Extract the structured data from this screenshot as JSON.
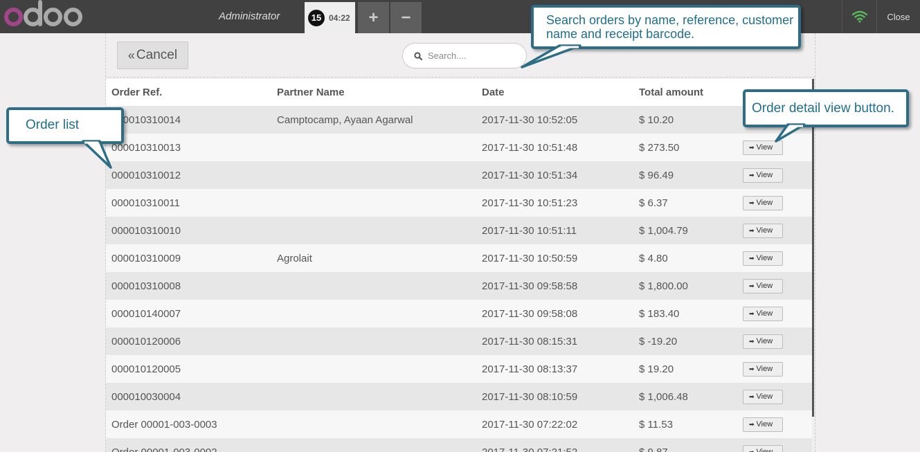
{
  "topbar": {
    "logo_text": "odoo",
    "username": "Administrator",
    "order_tab": {
      "sequence": "15",
      "time": "04:22"
    },
    "add_label": "+",
    "remove_label": "−",
    "close_label": "Close",
    "wifi_color": "#5cb85c"
  },
  "screen": {
    "cancel_label": "Cancel",
    "search_placeholder": "Search....",
    "columns": [
      "Order Ref.",
      "Partner Name",
      "Date",
      "Total amount"
    ],
    "view_label": "View",
    "orders": [
      {
        "ref": "000010310014",
        "partner": "Camptocamp, Ayaan Agarwal",
        "date": "2017-11-30 10:52:05",
        "total": "$ 10.20",
        "has_view": false
      },
      {
        "ref": "000010310013",
        "partner": "",
        "date": "2017-11-30 10:51:48",
        "total": "$ 273.50",
        "has_view": true
      },
      {
        "ref": "000010310012",
        "partner": "",
        "date": "2017-11-30 10:51:34",
        "total": "$ 96.49",
        "has_view": true
      },
      {
        "ref": "000010310011",
        "partner": "",
        "date": "2017-11-30 10:51:23",
        "total": "$ 6.37",
        "has_view": true
      },
      {
        "ref": "000010310010",
        "partner": "",
        "date": "2017-11-30 10:51:11",
        "total": "$ 1,004.79",
        "has_view": true
      },
      {
        "ref": "000010310009",
        "partner": "Agrolait",
        "date": "2017-11-30 10:50:59",
        "total": "$ 4.80",
        "has_view": true
      },
      {
        "ref": "000010310008",
        "partner": "",
        "date": "2017-11-30 09:58:58",
        "total": "$ 1,800.00",
        "has_view": true
      },
      {
        "ref": "000010140007",
        "partner": "",
        "date": "2017-11-30 09:58:08",
        "total": "$ 183.40",
        "has_view": true
      },
      {
        "ref": "000010120006",
        "partner": "",
        "date": "2017-11-30 08:15:31",
        "total": "$ -19.20",
        "has_view": true
      },
      {
        "ref": "000010120005",
        "partner": "",
        "date": "2017-11-30 08:13:37",
        "total": "$ 19.20",
        "has_view": true
      },
      {
        "ref": "000010030004",
        "partner": "",
        "date": "2017-11-30 08:10:59",
        "total": "$ 1,006.48",
        "has_view": true
      },
      {
        "ref": "Order 00001-003-0003",
        "partner": "",
        "date": "2017-11-30 07:22:02",
        "total": "$ 11.53",
        "has_view": true
      },
      {
        "ref": "Order 00001-003-0002",
        "partner": "",
        "date": "2017-11-30 07:21:52",
        "total": "$ 9.87",
        "has_view": true
      }
    ]
  },
  "callouts": {
    "search": "Search orders by name, reference, customer name and receipt barcode.",
    "order_list": "Order list",
    "view_button": "Order detail view button."
  },
  "colors": {
    "topbar": "#414141",
    "callout_border": "#2d6e86",
    "callout_text": "#1f6f8b",
    "logo_accent": "#a24689"
  }
}
